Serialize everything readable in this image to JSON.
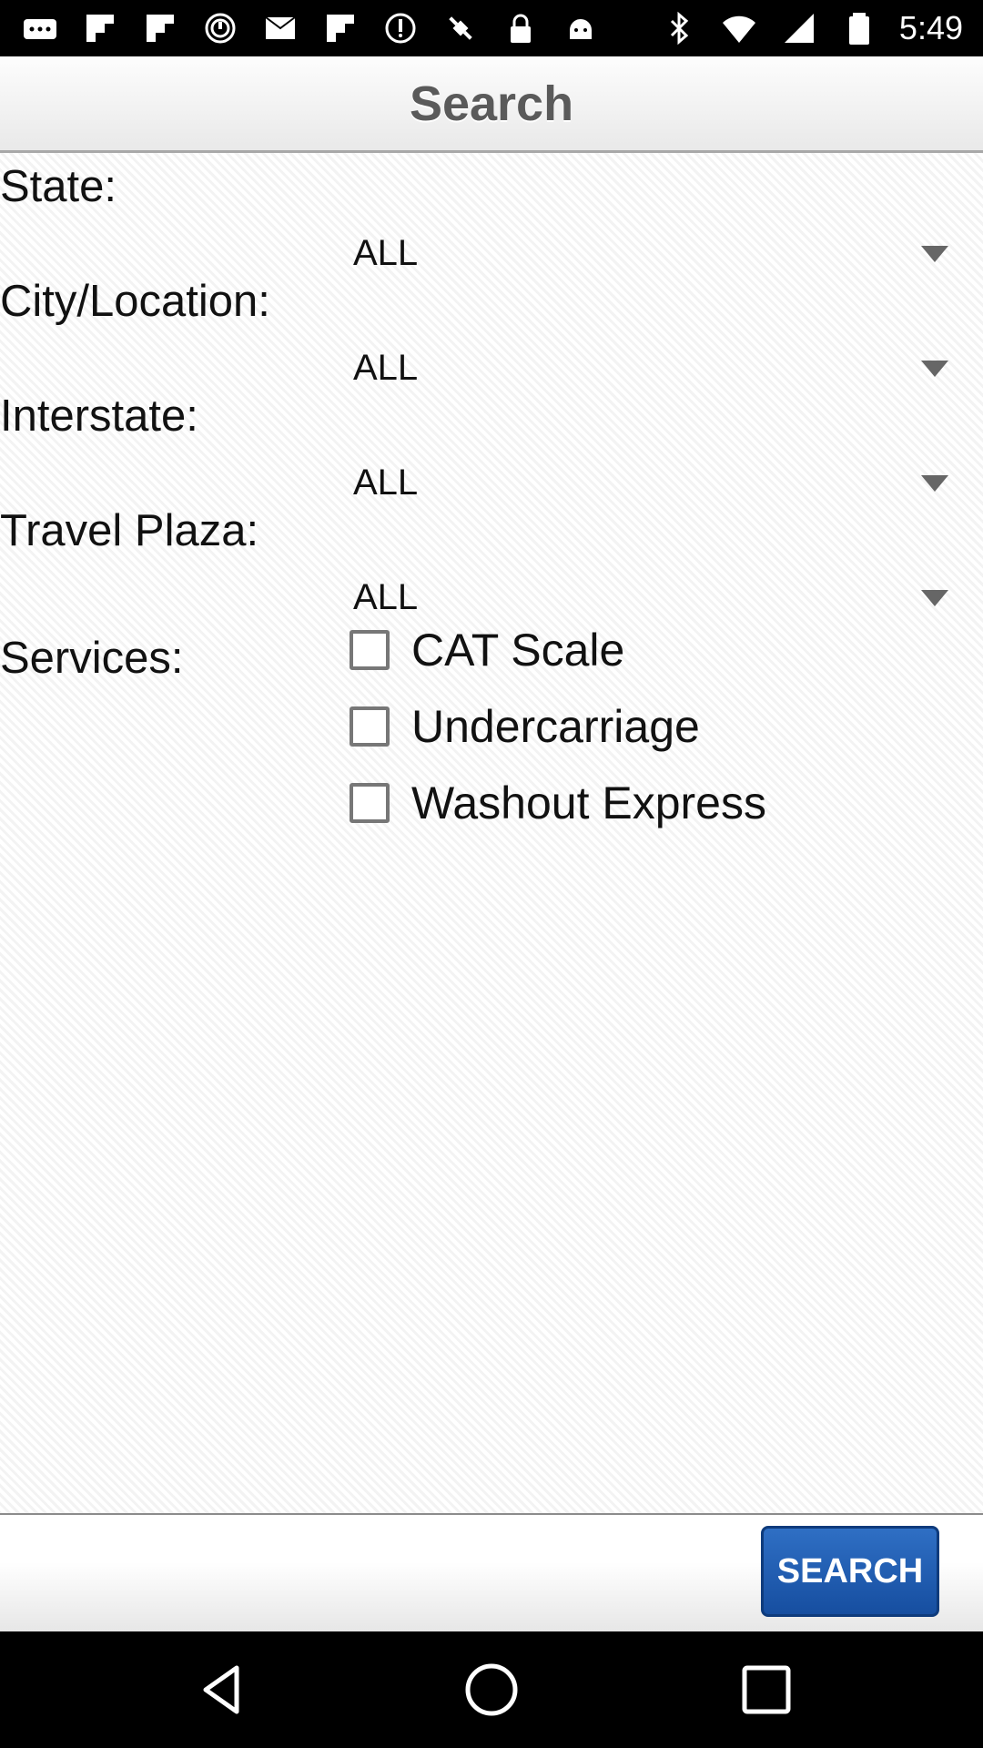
{
  "status_bar": {
    "time": "5:49",
    "icons": [
      "more-icon",
      "flipboard-icon",
      "flipboard-icon",
      "alarm-icon",
      "mail-icon",
      "flipboard-icon",
      "data-saver-icon",
      "fake-gps-icon",
      "lock-icon",
      "android-icon",
      "bluetooth-icon",
      "wifi-icon",
      "signal-icon",
      "battery-icon"
    ]
  },
  "header": {
    "title": "Search"
  },
  "filters": {
    "state": {
      "label": "State:",
      "value": "ALL"
    },
    "city": {
      "label": "City/Location:",
      "value": "ALL"
    },
    "interstate": {
      "label": "Interstate:",
      "value": "ALL"
    },
    "travel_plaza": {
      "label": "Travel Plaza:",
      "value": "ALL"
    }
  },
  "services": {
    "label": "Services:",
    "options": [
      {
        "label": "CAT Scale",
        "checked": false
      },
      {
        "label": "Undercarriage",
        "checked": false
      },
      {
        "label": "Washout Express",
        "checked": false
      }
    ]
  },
  "footer": {
    "search_label": "SEARCH"
  },
  "colors": {
    "button": "#1f5fb4",
    "header_text": "#5a5a5a"
  },
  "nav": [
    "back-icon",
    "home-icon",
    "recents-icon"
  ]
}
